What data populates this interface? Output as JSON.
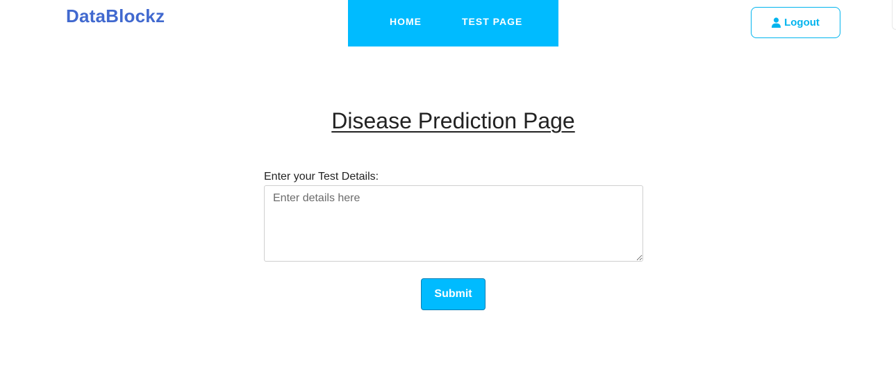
{
  "brand": {
    "name": "DataBlockz",
    "color": "#4169cf"
  },
  "nav": {
    "background": "#00bbff",
    "items": [
      {
        "label": "HOME"
      },
      {
        "label": "TEST PAGE"
      }
    ]
  },
  "logout": {
    "label": "Logout",
    "icon": "user-icon",
    "color": "#00b4ee"
  },
  "main": {
    "title": "Disease Prediction Page",
    "field_label": "Enter your Test Details:",
    "textarea": {
      "placeholder": "Enter details here",
      "value": ""
    },
    "submit_label": "Submit"
  }
}
